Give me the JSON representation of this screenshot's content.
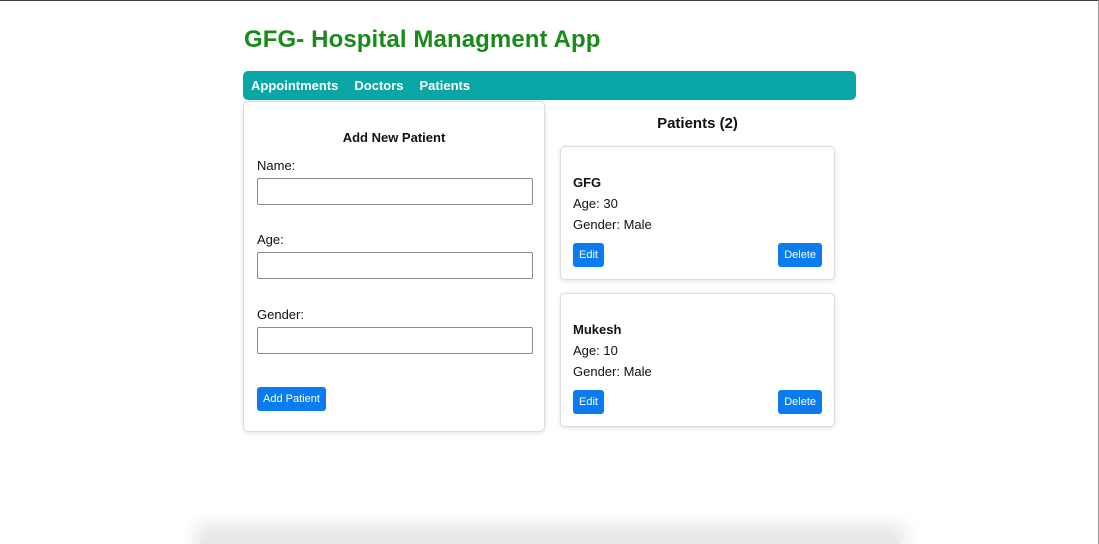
{
  "app": {
    "title": "GFG- Hospital Managment App"
  },
  "nav": {
    "items": [
      {
        "label": "Appointments"
      },
      {
        "label": "Doctors"
      },
      {
        "label": "Patients"
      }
    ]
  },
  "form": {
    "title": "Add New Patient",
    "fields": {
      "name": {
        "label": "Name:",
        "value": "",
        "placeholder": ""
      },
      "age": {
        "label": "Age:",
        "value": "",
        "placeholder": ""
      },
      "gender": {
        "label": "Gender:",
        "value": "",
        "placeholder": ""
      }
    },
    "submit_label": "Add Patient"
  },
  "patients": {
    "title": "Patients (2)",
    "items": [
      {
        "name": "GFG",
        "age": "Age: 30",
        "gender": "Gender: Male",
        "edit_label": "Edit",
        "delete_label": "Delete"
      },
      {
        "name": "Mukesh",
        "age": "Age: 10",
        "gender": "Gender: Male",
        "edit_label": "Edit",
        "delete_label": "Delete"
      }
    ]
  },
  "colors": {
    "title_green": "#1a8a1a",
    "nav_teal": "#0aa6a6",
    "button_blue": "#0a7cf0"
  }
}
